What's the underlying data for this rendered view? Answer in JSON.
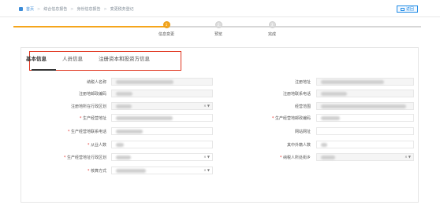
{
  "breadcrumb": {
    "home": "首页",
    "items": [
      "综合信息报告",
      "身份信息报告",
      "变更税务登记"
    ]
  },
  "toolbar": {
    "return": "返回"
  },
  "steps": [
    {
      "num": "1",
      "label": "信息变更"
    },
    {
      "num": "2",
      "label": "预览"
    },
    {
      "num": "3",
      "label": "完成"
    }
  ],
  "tabs": [
    "基本信息",
    "人员信息",
    "注册资本和投资方信息"
  ],
  "form": {
    "taxpayer_name": "纳税人名称",
    "reg_address": "注册地址",
    "reg_postal": "注册地邮政编码",
    "reg_phone": "注册地联系电话",
    "reg_district": "注册地所在行政区划",
    "business_scope": "经营范围",
    "prod_address": "生产经营地址",
    "prod_postal": "生产经营地邮政编码",
    "prod_phone": "生产经营地联系电话",
    "website": "网站网址",
    "employees": "从业人数",
    "foreign_employees": "其中外籍人数",
    "prod_district": "生产经营地址行政区划",
    "street": "纳税人所处街乡",
    "accounting": "核算方式"
  },
  "controls": {
    "clear": "×",
    "arrow": "▼"
  }
}
